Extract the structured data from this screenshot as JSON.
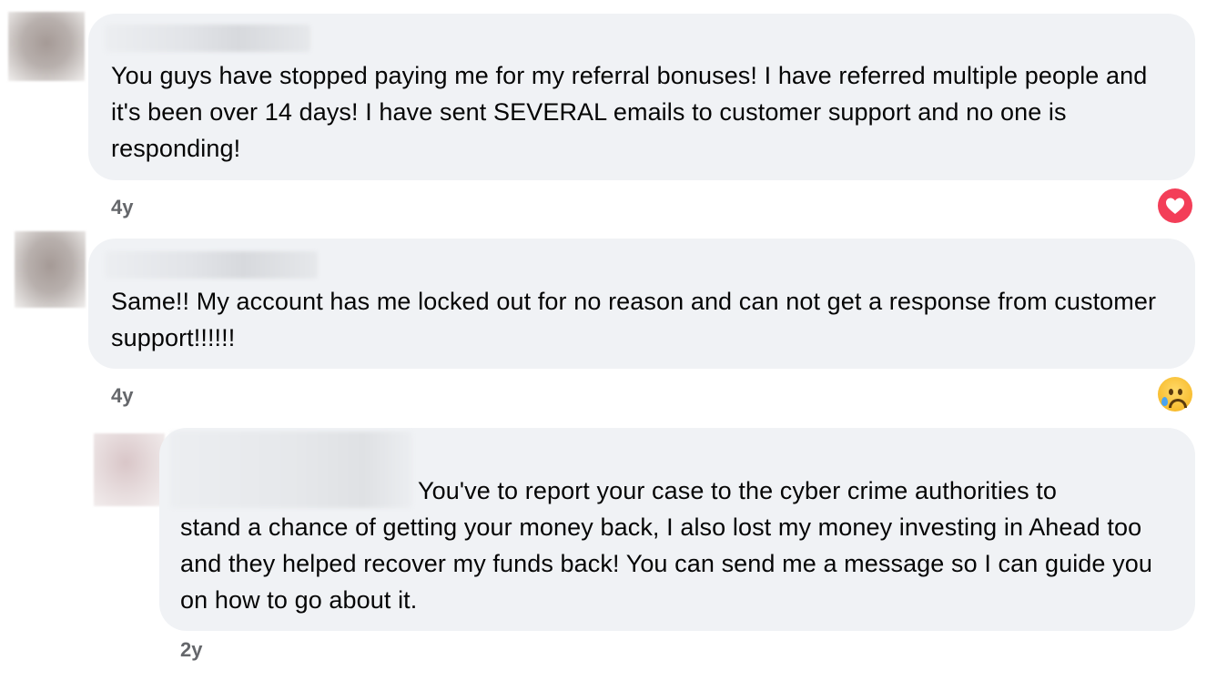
{
  "comments": [
    {
      "text": "You guys have stopped paying me for my referral bonuses! I have referred multiple people and it's been over 14 days! I have sent SEVERAL emails to customer support and no one is responding!",
      "time": "4y",
      "reaction": "love-reaction-icon"
    },
    {
      "text": "Same!! My account has me locked out for no reason and can not get a response from customer support!!!!!!",
      "time": "4y",
      "reaction": "sad-reaction-icon"
    },
    {
      "text_first": "You've to report your case to the cyber crime authorities to",
      "text_rest": "stand a chance of getting your money back, I also lost my money investing in Ahead too and they helped recover my funds back! You can send me a message so I can guide you on how to go about it.",
      "time": "2y"
    }
  ],
  "colors": {
    "bubble": "#f0f2f5",
    "meta": "#65676b",
    "love": "#f33e58",
    "sad": "#f7b928"
  }
}
